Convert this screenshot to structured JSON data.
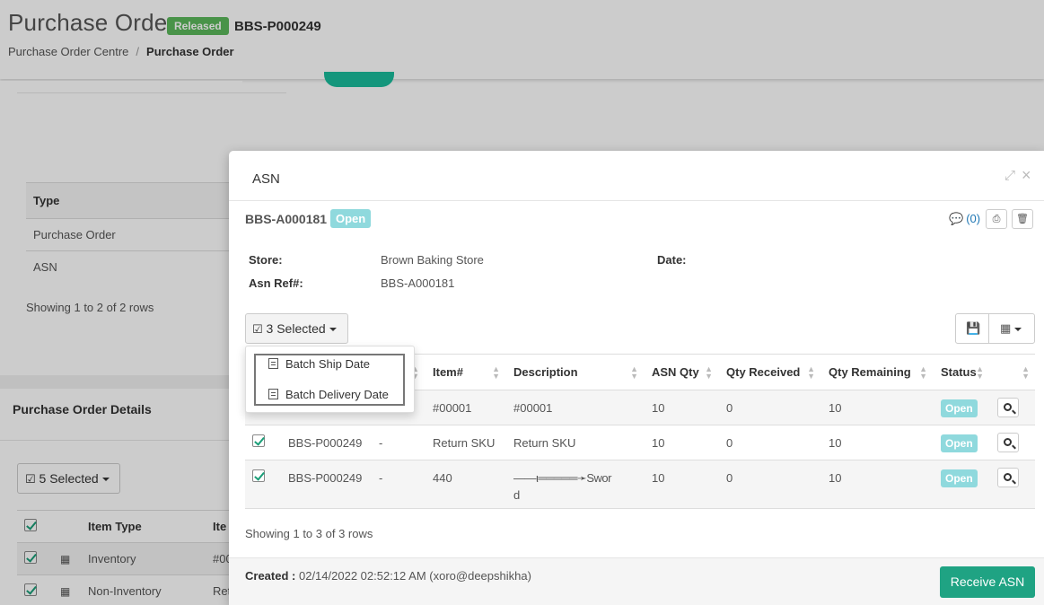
{
  "page": {
    "title": "Purchase Order",
    "status": "Released",
    "po_number": "BBS-P000249",
    "breadcrumb": [
      "Purchase Order Centre",
      "/",
      "Purchase Order"
    ]
  },
  "bg_types": {
    "header": "Type",
    "rows": [
      "Purchase Order",
      "ASN"
    ],
    "showing": "Showing 1 to 2 of 2 rows"
  },
  "bg_details": {
    "title": "Purchase Order Details",
    "selected": "5 Selected",
    "header": {
      "item_type": "Item Type",
      "item": "Ite"
    },
    "rows": [
      {
        "type": "Inventory",
        "item": "#00"
      },
      {
        "type": "Non-Inventory",
        "item": "Ret"
      }
    ]
  },
  "modal": {
    "title": "ASN",
    "asn_number": "BBS-A000181",
    "status": "Open",
    "comments": "(0)",
    "info": {
      "store_label": "Store:",
      "store_value": "Brown Baking Store",
      "date_label": "Date:",
      "ref_label": "Asn Ref#:",
      "ref_value": "BBS-A000181"
    },
    "selected_label": "3 Selected",
    "dropdown": [
      "Batch Ship Date",
      "Batch Delivery Date"
    ],
    "columns": [
      "Item#",
      "Description",
      "ASN Qty",
      "Qty Received",
      "Qty Remaining",
      "Status"
    ],
    "rows": [
      {
        "po": "",
        "dash": "",
        "item": "#00001",
        "desc": "#00001",
        "asn_qty": "10",
        "received": "0",
        "remaining": "10",
        "status": "Open"
      },
      {
        "po": "BBS-P000249",
        "dash": "-",
        "item": "Return SKU",
        "desc": "Return SKU",
        "asn_qty": "10",
        "received": "0",
        "remaining": "10",
        "status": "Open"
      },
      {
        "po": "BBS-P000249",
        "dash": "-",
        "item": "440",
        "desc": "——ι═════➛Swor",
        "desc2": "d",
        "asn_qty": "10",
        "received": "0",
        "remaining": "10",
        "status": "Open"
      }
    ],
    "showing": "Showing 1 to 3 of 3 rows",
    "created_label": "Created :",
    "created_value": "02/14/2022 02:52:12 AM (xoro@deepshikha)",
    "receive_button": "Receive ASN"
  },
  "colors": {
    "accent": "#1fa383",
    "released": "#5cb85c",
    "open_badge": "#8fd9dd"
  }
}
